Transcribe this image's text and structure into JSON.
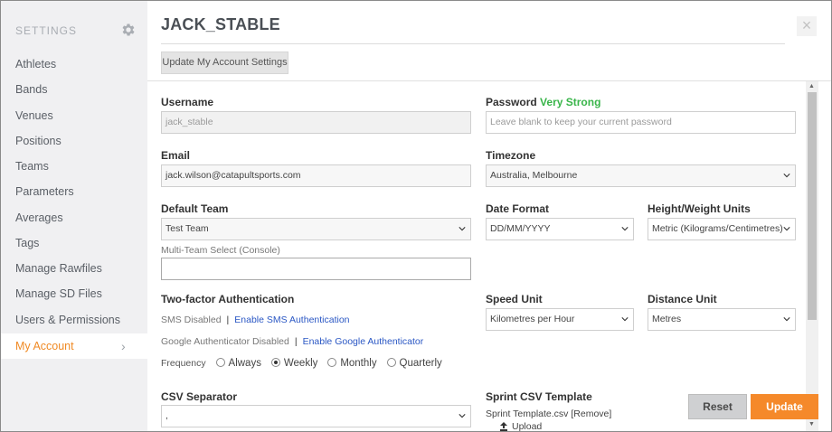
{
  "sidebar": {
    "title": "SETTINGS",
    "gear_icon": "gear-icon",
    "items": [
      {
        "label": "Athletes"
      },
      {
        "label": "Bands"
      },
      {
        "label": "Venues"
      },
      {
        "label": "Positions"
      },
      {
        "label": "Teams"
      },
      {
        "label": "Parameters"
      },
      {
        "label": "Averages"
      },
      {
        "label": "Tags"
      },
      {
        "label": "Manage Rawfiles"
      },
      {
        "label": "Manage SD Files"
      },
      {
        "label": "Users & Permissions"
      }
    ],
    "active": {
      "label": "My Account",
      "chevron": "›"
    },
    "accent_color": "#f08a24"
  },
  "header": {
    "title": "JACK_STABLE",
    "close": "×",
    "tab_button": "Update My Account Settings"
  },
  "form": {
    "username": {
      "label": "Username",
      "value": "jack_stable"
    },
    "password": {
      "label": "Password",
      "strength": "Very Strong",
      "placeholder": "Leave blank to keep your current password"
    },
    "email": {
      "label": "Email",
      "value": "jack.wilson@catapultsports.com"
    },
    "timezone": {
      "label": "Timezone",
      "value": "Australia, Melbourne"
    },
    "default_team": {
      "label": "Default Team",
      "value": "Test Team"
    },
    "date_format": {
      "label": "Date Format",
      "value": "DD/MM/YYYY"
    },
    "height_weight": {
      "label": "Height/Weight Units",
      "value": "Metric (Kilograms/Centimetres)"
    },
    "multi_team": {
      "label": "Multi-Team Select (Console)",
      "value": ""
    },
    "two_factor": {
      "label": "Two-factor Authentication",
      "sms_status": "SMS Disabled",
      "sms_link": "Enable SMS Authentication",
      "google_status": "Google Authenticator Disabled",
      "google_link": "Enable Google Authenticator",
      "separator": "|",
      "frequency_label": "Frequency",
      "options": [
        "Always",
        "Weekly",
        "Monthly",
        "Quarterly"
      ],
      "selected": "Weekly"
    },
    "speed_unit": {
      "label": "Speed Unit",
      "value": "Kilometres per Hour"
    },
    "distance_unit": {
      "label": "Distance Unit",
      "value": "Metres"
    },
    "csv_separator": {
      "label": "CSV Separator",
      "value": ","
    },
    "sprint_csv": {
      "label": "Sprint CSV Template",
      "file": "Sprint Template.csv",
      "remove": "[Remove]",
      "upload": "Upload"
    }
  },
  "actions": {
    "reset": "Reset",
    "update": "Update",
    "update_color": "#f5892a"
  }
}
